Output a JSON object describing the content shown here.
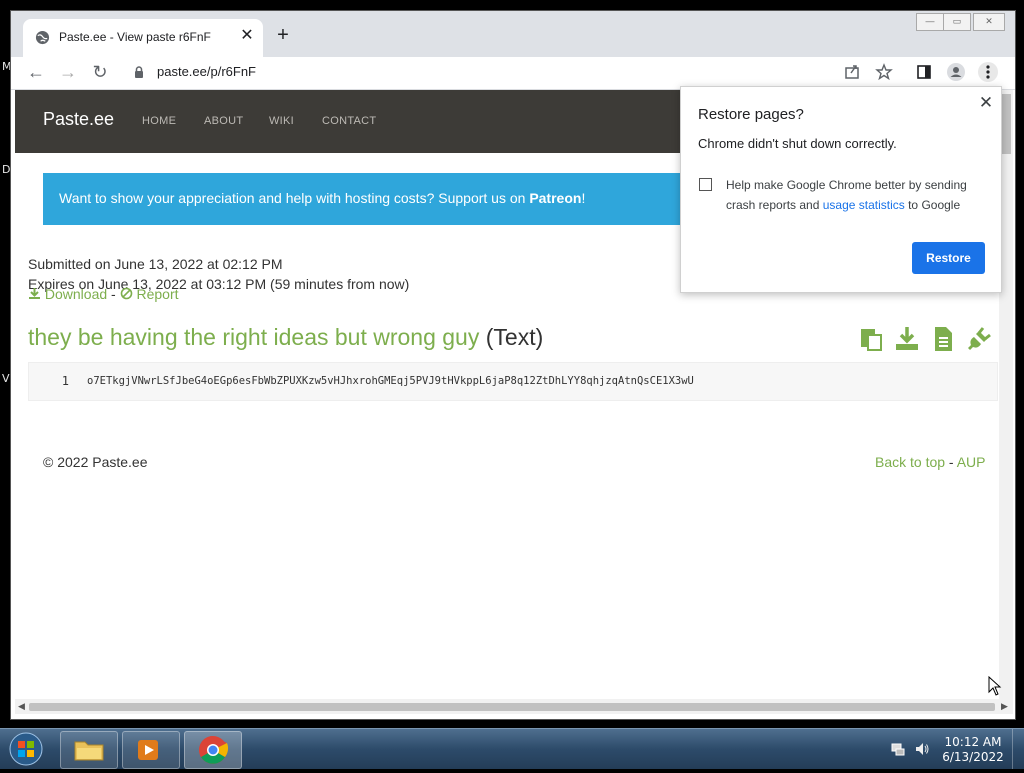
{
  "desktop": {
    "letters": [
      "M",
      "D",
      "V"
    ]
  },
  "browser": {
    "tab_title": "Paste.ee - View paste r6FnF",
    "tab_close": "✕",
    "new_tab": "+",
    "url": "paste.ee/p/r6FnF"
  },
  "site": {
    "brand": "Paste.ee",
    "nav": [
      "HOME",
      "ABOUT",
      "WIKI",
      "CONTACT"
    ],
    "banner_text": "Want to show your appreciation and help with hosting costs? Support us on ",
    "banner_link": "Patreon",
    "banner_end": "!",
    "submitted": "Submitted on June 13, 2022 at 02:12 PM",
    "expires": "Expires on June 13, 2022 at 03:12 PM (59 minutes from now)",
    "download": "Download",
    "separator": " - ",
    "report": "Report",
    "paste_title": "they be having the right ideas but wrong guy",
    "paste_kind": " (Text)",
    "line_number": "1",
    "code": "o7ETkgjVNwrLSfJbeG4oEGp6esFbWbZPUXKzw5vHJhxrohGMEqj5PVJ9tHVkppL6jaP8q12ZtDhLYY8qhjzqAtnQsCE1X3wU",
    "footer_left": "© 2022 Paste.ee",
    "back_to_top": "Back to top",
    "aup": "AUP"
  },
  "popup": {
    "title": "Restore pages?",
    "message": "Chrome didn't shut down correctly.",
    "checkbox_text_1": "Help make Google Chrome better by sending crash reports and ",
    "checkbox_link": "usage statistics",
    "checkbox_text_2": " to Google",
    "restore_button": "Restore",
    "close": "✕"
  },
  "taskbar": {
    "time": "10:12 AM",
    "date": "6/13/2022"
  },
  "colors": {
    "accent_green": "#7dae4d",
    "banner_blue": "#2fa6db",
    "chrome_blue": "#1a73e8",
    "nav_dark": "#3d3b37"
  },
  "icons": [
    "globe-icon",
    "back-icon",
    "forward-icon",
    "reload-icon",
    "lock-icon",
    "share-icon",
    "star-icon",
    "side-panel-icon",
    "profile-icon",
    "menu-icon",
    "download-icon",
    "report-icon",
    "copy-icon",
    "file-icon",
    "plugin-icon",
    "start-orb-icon",
    "folder-icon",
    "media-player-icon",
    "chrome-icon",
    "network-icon",
    "volume-icon"
  ]
}
